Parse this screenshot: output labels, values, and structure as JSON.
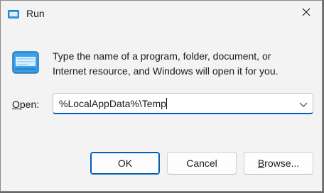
{
  "window": {
    "title": "Run",
    "close_icon": "close-icon"
  },
  "message": {
    "line1": "Type the name of a program, folder, document, or",
    "line2": "Internet resource, and Windows will open it for you."
  },
  "open_field": {
    "label_mnemonic": "O",
    "label_rest": "pen:",
    "value": "%LocalAppData%\\Temp"
  },
  "buttons": {
    "ok": "OK",
    "cancel": "Cancel",
    "browse_mnemonic": "B",
    "browse_rest": "rowse..."
  },
  "colors": {
    "accent": "#005fb8",
    "window_bg": "#f3f3f3",
    "icon_blue": "#3aa0e8"
  },
  "icons": {
    "app": "run-icon",
    "dialog": "run-icon",
    "dropdown": "chevron-down-icon"
  }
}
